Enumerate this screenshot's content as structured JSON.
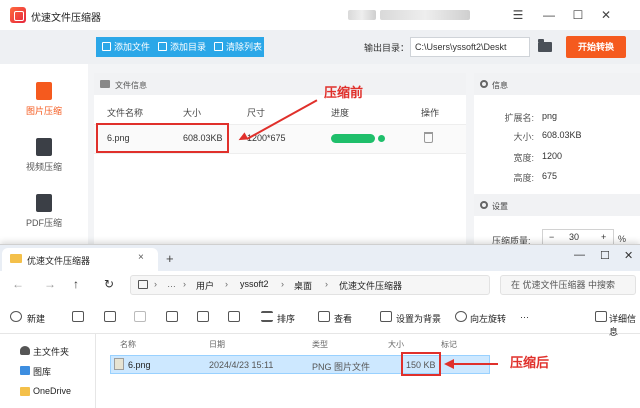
{
  "app": {
    "title": "优速文件压缩器",
    "window_controls": [
      "☰",
      "—",
      "☐",
      "✕"
    ]
  },
  "toolbar": {
    "add_file": "添加文件",
    "add_dir": "添加目录",
    "clear_list": "清除列表",
    "output_label": "输出目录：",
    "output_path": "C:\\Users\\yssoft2\\Deskt",
    "start": "开始转换"
  },
  "sidebar": {
    "items": [
      {
        "label": "图片压缩",
        "active": true,
        "icon": "image-compress-icon"
      },
      {
        "label": "视频压缩",
        "active": false,
        "icon": "video-compress-icon"
      },
      {
        "label": "PDF压缩",
        "active": false,
        "icon": "pdf-compress-icon"
      }
    ]
  },
  "file_panel": {
    "title": "文件信息",
    "columns": {
      "name": "文件名称",
      "size": "大小",
      "dims": "尺寸",
      "progress": "进度",
      "action": "操作"
    },
    "rows": [
      {
        "name": "6.png",
        "size": "608.03KB",
        "dims": "1200*675",
        "progress": 1.0
      }
    ]
  },
  "info_panel": {
    "title": "信息",
    "fields": [
      {
        "key": "扩展名:",
        "value": "png"
      },
      {
        "key": "大小:",
        "value": "608.03KB"
      },
      {
        "key": "宽度:",
        "value": "1200"
      },
      {
        "key": "高度:",
        "value": "675"
      }
    ],
    "settings_title": "设置",
    "quality_label": "压缩质量:",
    "quality_minus": "−",
    "quality_value": "30",
    "quality_plus": "+",
    "quality_unit": "%"
  },
  "annotations": {
    "before": "压缩前",
    "after": "压缩后",
    "color": "#e0302b"
  },
  "explorer": {
    "tab_title": "优速文件压缩器",
    "tab_close": "×",
    "new_tab": "+",
    "window_controls": [
      "—",
      "☐",
      "✕"
    ],
    "nav": {
      "back": "←",
      "forward": "→",
      "up": "↑",
      "refresh": "↻"
    },
    "breadcrumb": [
      "用户",
      "yssoft2",
      "桌面",
      "优速文件压缩器"
    ],
    "breadcrumb_sep": "›",
    "more": "…",
    "search_placeholder": "在 优速文件压缩器 中搜索",
    "commands": {
      "new": "新建",
      "sort": "排序",
      "view": "查看",
      "set_background": "设置为背景",
      "rotate_left": "向左旋转",
      "more": "···",
      "details": "详细信息"
    },
    "nav_pane": [
      "主文件夹",
      "图库",
      "OneDrive"
    ],
    "columns": {
      "name": "名称",
      "date": "日期",
      "type": "类型",
      "size": "大小",
      "tags": "标记"
    },
    "rows": [
      {
        "name": "6.png",
        "date": "2024/4/23 15:11",
        "type": "PNG 图片文件",
        "size": "150 KB"
      }
    ]
  }
}
